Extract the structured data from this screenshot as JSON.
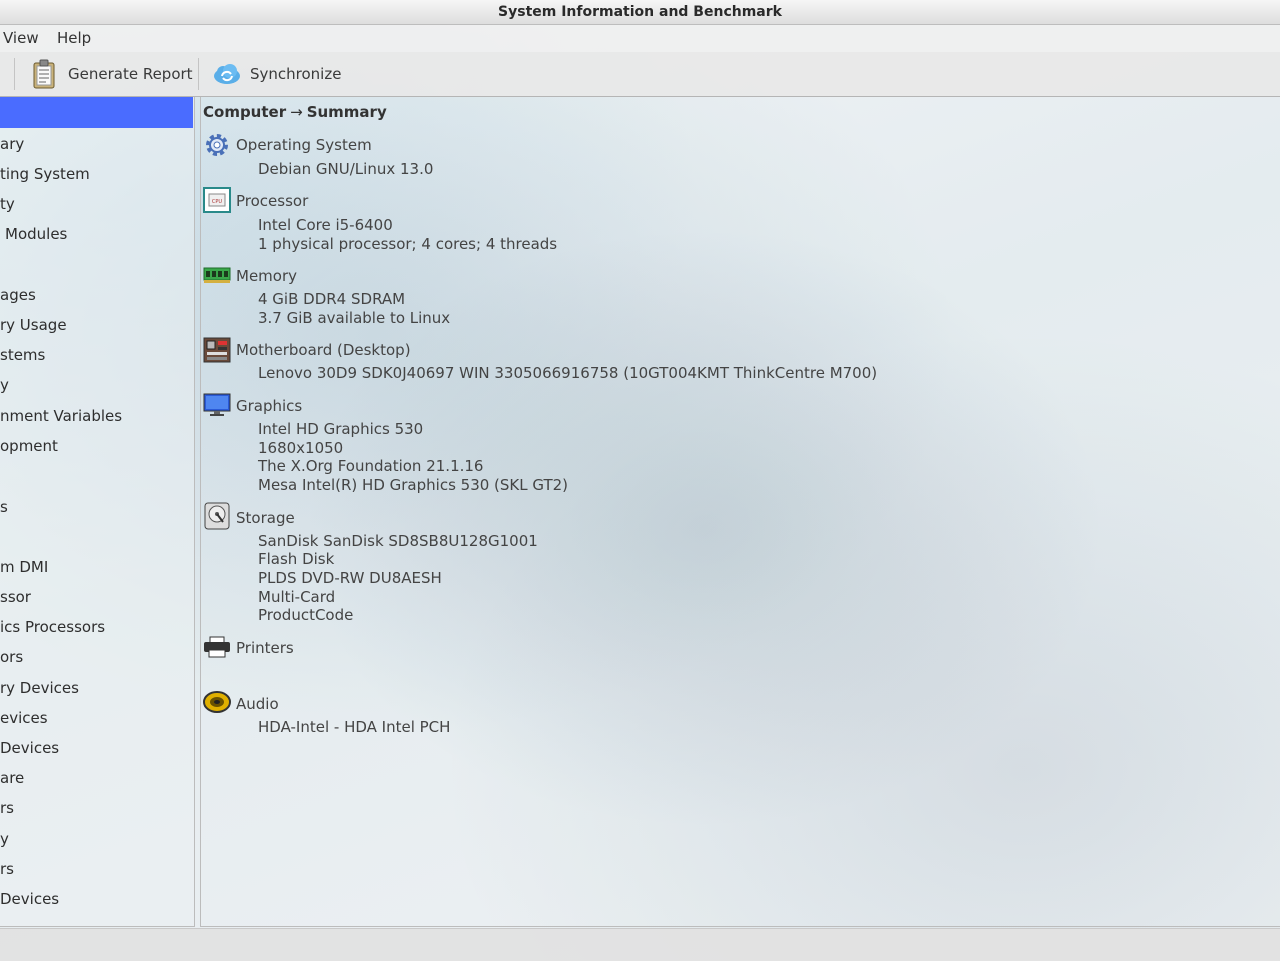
{
  "window": {
    "title": "System Information and Benchmark"
  },
  "menu": {
    "view": "View",
    "help": "Help"
  },
  "toolbar": {
    "generate_report": "Generate Report",
    "synchronize": "Synchronize"
  },
  "sidebar": {
    "items": [
      "ary",
      "ting System",
      "ty",
      "Modules",
      "ages",
      "ry Usage",
      "stems",
      "y",
      "nment Variables",
      "opment",
      "s",
      "m DMI",
      "ssor",
      "ics Processors",
      "ors",
      "ry Devices",
      "evices",
      "Devices",
      "are",
      "rs",
      "y",
      "rs",
      "Devices"
    ]
  },
  "breadcrumb": {
    "root": "Computer",
    "arrow": "→",
    "current": "Summary"
  },
  "sections": {
    "os": {
      "title": "Operating System",
      "lines": [
        "Debian GNU/Linux 13.0"
      ]
    },
    "processor": {
      "title": "Processor",
      "lines": [
        "Intel Core i5-6400",
        "1 physical processor; 4 cores; 4 threads"
      ]
    },
    "memory": {
      "title": "Memory",
      "lines": [
        "4 GiB DDR4 SDRAM",
        "3.7 GiB available to Linux"
      ]
    },
    "motherboard": {
      "title": "Motherboard (Desktop)",
      "lines": [
        "Lenovo 30D9 SDK0J40697 WIN 3305066916758 (10GT004KMT ThinkCentre M700)"
      ]
    },
    "graphics": {
      "title": "Graphics",
      "lines": [
        "Intel HD Graphics 530",
        "1680x1050",
        "The X.Org Foundation 21.1.16",
        "Mesa Intel(R) HD Graphics 530 (SKL GT2)"
      ]
    },
    "storage": {
      "title": "Storage",
      "lines": [
        "SanDisk SanDisk SD8SB8U128G1001",
        "Flash Disk",
        "PLDS  DVD-RW DU8AESH",
        "Multi-Card",
        "ProductCode"
      ]
    },
    "printers": {
      "title": "Printers",
      "lines": []
    },
    "audio": {
      "title": "Audio",
      "lines": [
        "HDA-Intel - HDA Intel PCH"
      ]
    }
  },
  "colors": {
    "selection": "#4a6cff",
    "icon_cpu": "#2a8a8a",
    "icon_memory": "#3aa84a",
    "icon_audio": "#e0b000"
  }
}
